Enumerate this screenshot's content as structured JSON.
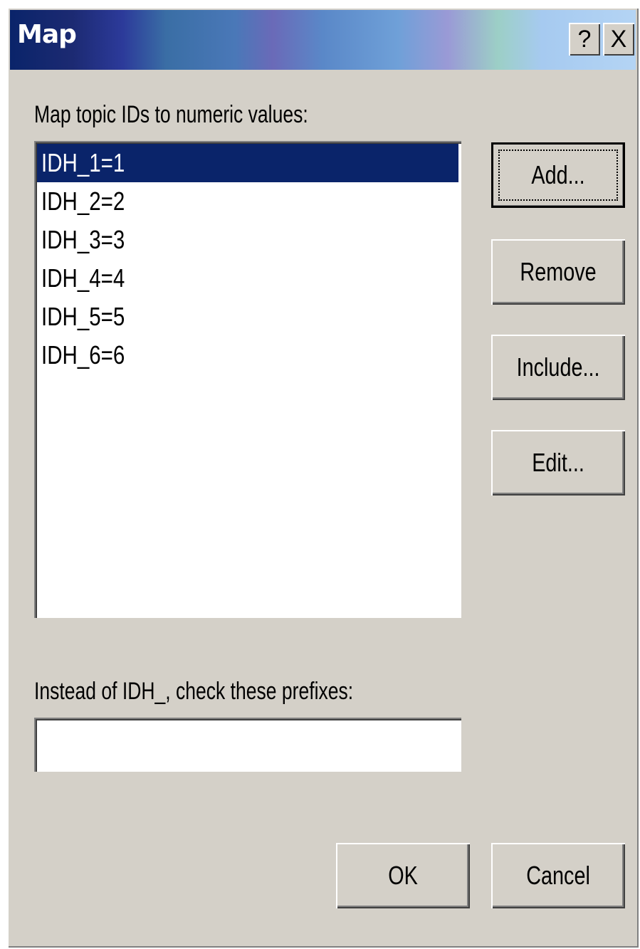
{
  "window": {
    "title": "Map",
    "help_label": "?",
    "close_label": "X"
  },
  "map_label": "Map topic IDs to numeric values:",
  "list": {
    "items": [
      "IDH_1=1",
      "IDH_2=2",
      "IDH_3=3",
      "IDH_4=4",
      "IDH_5=5",
      "IDH_6=6"
    ],
    "selected_index": 0
  },
  "buttons": {
    "add": "Add...",
    "remove": "Remove",
    "include": "Include...",
    "edit": "Edit...",
    "ok": "OK",
    "cancel": "Cancel"
  },
  "prefix": {
    "label": "Instead of IDH_, check these prefixes:",
    "value": ""
  },
  "colors": {
    "face": "#d4d0c8",
    "selection": "#0a246a"
  }
}
